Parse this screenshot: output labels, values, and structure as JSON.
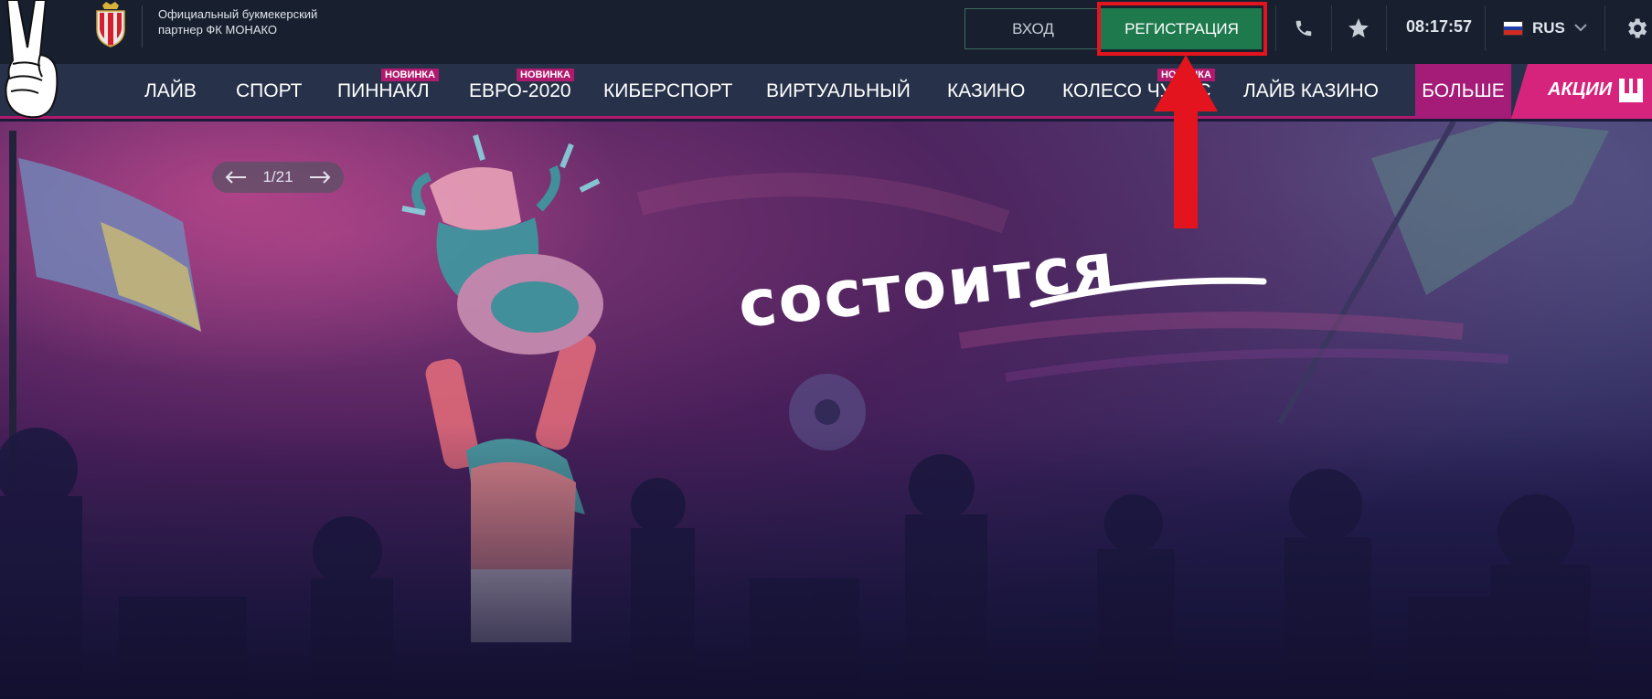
{
  "header": {
    "partner_text_line1": "Официальный букмекерский",
    "partner_text_line2": "партнер ФК МОНАКО",
    "login_label": "ВХОД",
    "register_label": "РЕГИСТРАЦИЯ",
    "phone_icon": "phone-icon",
    "favorites_icon": "star-icon",
    "clock": "08:17:57",
    "language": "RUS",
    "settings_icon": "gear-icon"
  },
  "nav": {
    "items": [
      {
        "label": "ЛАЙВ",
        "badge": ""
      },
      {
        "label": "СПОРТ",
        "badge": ""
      },
      {
        "label": "ПИННАКЛ",
        "badge": "НОВИНКА"
      },
      {
        "label": "ЕВРО-2020",
        "badge": "НОВИНКА"
      },
      {
        "label": "КИБЕРСПОРТ",
        "badge": ""
      },
      {
        "label": "ВИРТУАЛЬНЫЙ",
        "badge": ""
      },
      {
        "label": "КАЗИНО",
        "badge": ""
      },
      {
        "label": "КОЛЕСО ЧУДЕС",
        "badge": "НОВИНКА"
      },
      {
        "label": "ЛАЙВ КАЗИНО",
        "badge": ""
      }
    ],
    "more_label": "БОЛЬШЕ",
    "promo_label": "АКЦИИ"
  },
  "hero": {
    "slide_counter": "1/21",
    "title": "состоится"
  },
  "colors": {
    "topbar": "#182030",
    "navbar": "#27324a",
    "register_green": "#1e7a4c",
    "accent_magenta": "#b01a6e",
    "annotation_red": "#e4141e"
  }
}
